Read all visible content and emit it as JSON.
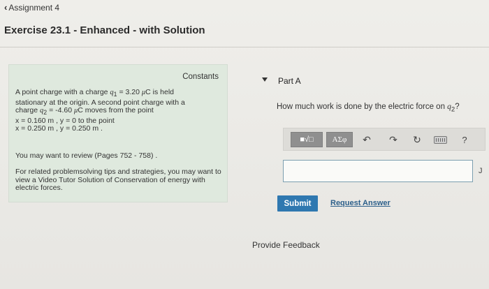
{
  "header": {
    "back_label": "Assignment 4",
    "exercise_title": "Exercise 23.1 - Enhanced - with Solution"
  },
  "problem": {
    "constants_label": "Constants",
    "line1_a": "A point charge with a charge ",
    "q1_sym": "q",
    "q1_sub": "1",
    "line1_b": " = 3.20 ",
    "mu": "μ",
    "C": "C",
    "line1_c": " is held",
    "line2": "stationary at the origin. A second point charge with a",
    "line3_a": "charge ",
    "q2_sym": "q",
    "q2_sub": "2",
    "line3_b": " = -4.60 ",
    "line3_c": " moves from the point",
    "line4": "x = 0.160 m , y = 0 to the point",
    "line5": "x = 0.250 m , y = 0.250 m .",
    "review": "You may want to review (Pages 752 - 758) .",
    "tips": "For related problemsolving tips and strategies, you may want to view a Video Tutor Solution of Conservation of energy with electric forces."
  },
  "part": {
    "title": "Part A",
    "question_a": "How much work is done by the electric force on ",
    "q_sym": "q",
    "q_sub": "2",
    "question_b": "?"
  },
  "toolbar": {
    "templates_label": "■√□",
    "symbols_label": "ΑΣφ",
    "undo_icon": "↶",
    "redo_icon": "↷",
    "reset_icon": "↻",
    "help_label": "?"
  },
  "answer": {
    "value": "",
    "unit": "J"
  },
  "actions": {
    "submit_label": "Submit",
    "request_label": "Request Answer",
    "feedback_label": "Provide Feedback"
  }
}
